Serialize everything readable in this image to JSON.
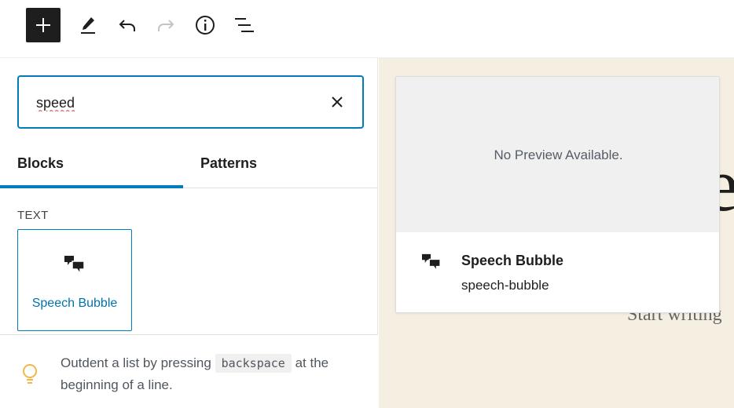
{
  "toolbar": {
    "add_icon": "plus-icon",
    "edit_icon": "pencil-icon",
    "undo_icon": "undo-icon",
    "redo_icon": "redo-icon",
    "info_icon": "info-icon",
    "list_icon": "list-view-icon"
  },
  "inserter": {
    "search": {
      "value": "speed"
    },
    "tabs": [
      {
        "label": "Blocks",
        "active": true
      },
      {
        "label": "Patterns",
        "active": false
      }
    ],
    "category": "TEXT",
    "blocks": [
      {
        "label": "Speech Bubble",
        "icon": "speech-bubble-icon"
      }
    ],
    "tip": {
      "before": "Outdent a list by pressing",
      "code": "backspace",
      "after": "at the beginning of a line."
    }
  },
  "preview": {
    "empty_text": "No Preview Available.",
    "title": "Speech Bubble",
    "description": "speech-bubble"
  },
  "canvas": {
    "bg_glyph": "e)",
    "bg_text": "Start writing"
  },
  "colors": {
    "accent": "#007cba",
    "toolbar_add_bg": "#1e1e1e",
    "canvas_bg": "#f4efe1",
    "tip_bulb": "#f0b849"
  }
}
